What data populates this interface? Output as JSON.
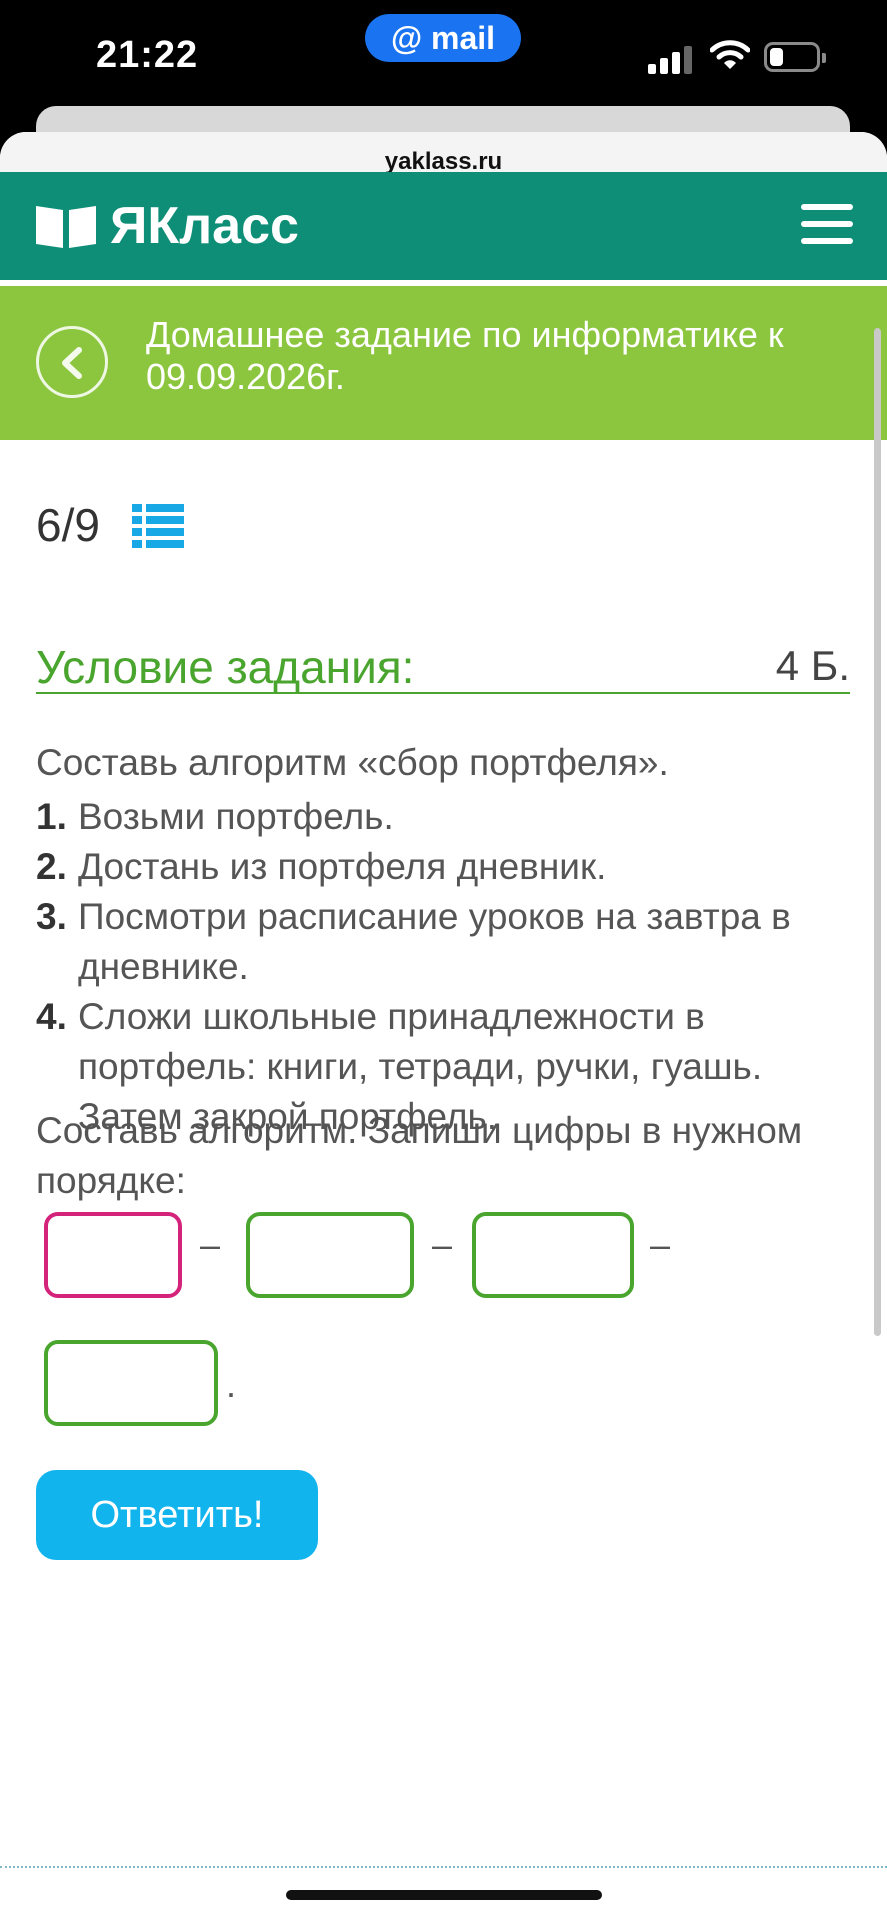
{
  "status_bar": {
    "time": "21:22",
    "mail_pill": "@ mail",
    "battery_level": 0.3
  },
  "browser": {
    "url": "yaklass.ru"
  },
  "site_header": {
    "logo_text": "ЯКласс",
    "logo_icon": "open-book-icon",
    "menu_icon": "hamburger-menu-icon",
    "color": "#0e8e76"
  },
  "title_bar": {
    "title": "Домашнее задание по информатике к 09.09.2026г.",
    "back_icon": "chevron-left-icon",
    "color": "#8cc63f"
  },
  "task": {
    "progress": "6/9",
    "list_icon": "list-icon",
    "condition_title": "Условие задания:",
    "points": "4 Б.",
    "intro": "Составь алгоритм «сбор портфеля».",
    "steps": [
      {
        "num": "1.",
        "text": "Возьми портфель."
      },
      {
        "num": "2.",
        "text": "Достань из портфеля дневник."
      },
      {
        "num": "3.",
        "text": "Посмотри расписание уроков на завтра в дневнике."
      },
      {
        "num": "4.",
        "text": "Сложи школьные принадлежности в портфель: книги, тетради, ручки, гуашь. Затем закрой портфель."
      }
    ],
    "instruction": "Составь алгоритм. Запиши цифры в нужном порядке:",
    "answer_fields": [
      "",
      "",
      "",
      ""
    ],
    "separator": "–",
    "terminator": ".",
    "submit_label": "Ответить!"
  },
  "colors": {
    "accent_green": "#4aa52e",
    "active_field": "#d4237a",
    "submit_blue": "#12b4ee"
  }
}
